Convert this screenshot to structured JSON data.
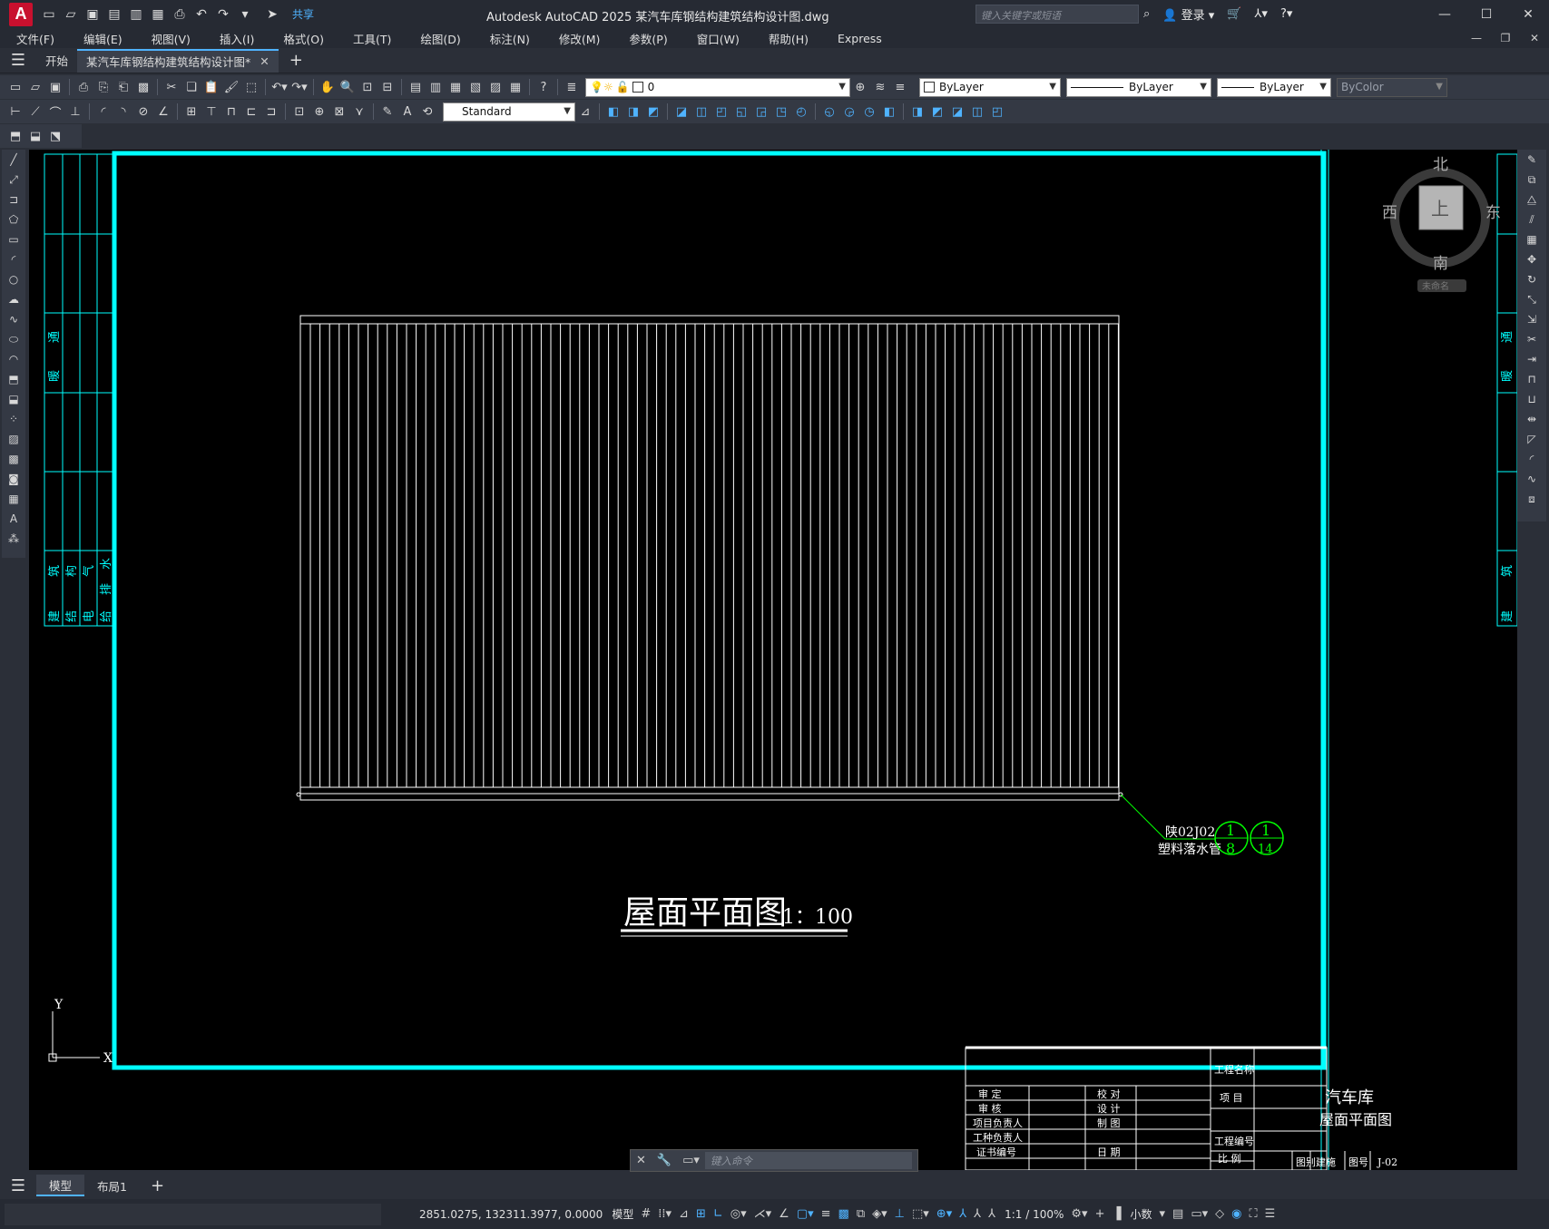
{
  "titlebar": {
    "app_logo": "A",
    "share_label": "共享",
    "title": "Autodesk AutoCAD 2025    某汽车库钢结构建筑结构设计图.dwg",
    "search_placeholder": "键入关键字或短语",
    "login_label": "登录"
  },
  "menubar": [
    "文件(F)",
    "编辑(E)",
    "视图(V)",
    "插入(I)",
    "格式(O)",
    "工具(T)",
    "绘图(D)",
    "标注(N)",
    "修改(M)",
    "参数(P)",
    "窗口(W)",
    "帮助(H)",
    "Express"
  ],
  "tabs": {
    "start": "开始",
    "active_doc": "某汽车库钢结构建筑结构设计图*"
  },
  "toolbar": {
    "layer_value": "0",
    "color_value": "ByLayer",
    "linetype_value": "ByLayer",
    "lineweight_value": "ByLayer",
    "plotstyle_value": "ByColor",
    "textstyle_value": "Standard"
  },
  "viewcube": {
    "north": "北",
    "south": "南",
    "east": "东",
    "west": "西",
    "top": "上",
    "ucs_name": "未命名"
  },
  "drawing": {
    "leader_line1": "陕02J02",
    "leader_line2": "塑料落水管",
    "detail1_top": "1",
    "detail1_bottom": "8",
    "detail2_top": "1",
    "detail2_bottom": "14",
    "plan_title": "屋面平面图",
    "plan_scale": "1：100",
    "ucs_y": "Y",
    "ucs_x": "X",
    "side_labels_top": [
      "暖",
      "通"
    ],
    "side_labels_bottom": [
      "建",
      "筑",
      "结",
      "构",
      "电",
      "气",
      "给",
      "排",
      "水"
    ],
    "right_side_top": [
      "暖",
      "通"
    ],
    "right_side_bottom": [
      "建",
      "筑"
    ]
  },
  "titleblock": {
    "project_name_label": "工程名称",
    "item_label": "项 目",
    "item_value": "汽车库",
    "drawing_name": "屋面平面图",
    "approve": "审 定",
    "review": "审 核",
    "project_lead": "项目负责人",
    "discipline_lead": "工种负责人",
    "cert_no": "证书编号",
    "check": "校 对",
    "design": "设 计",
    "draw": "制 图",
    "date": "日 期",
    "project_no": "工程编号",
    "scale": "比 例",
    "drawing_type_label": "图别",
    "drawing_type": "建施",
    "drawing_no_label": "图号",
    "drawing_no": "J-02"
  },
  "commandline": {
    "placeholder": "键入命令"
  },
  "bottom_tabs": [
    "模型",
    "布局1"
  ],
  "statusbar": {
    "coords": "2851.0275, 132311.3977, 0.0000",
    "model": "模型",
    "annotation_scale": "1:1 / 100%",
    "units": "小数"
  },
  "colors": {
    "frame": "#00ffff",
    "green": "#00ff00",
    "accent": "#4fb3ff"
  }
}
